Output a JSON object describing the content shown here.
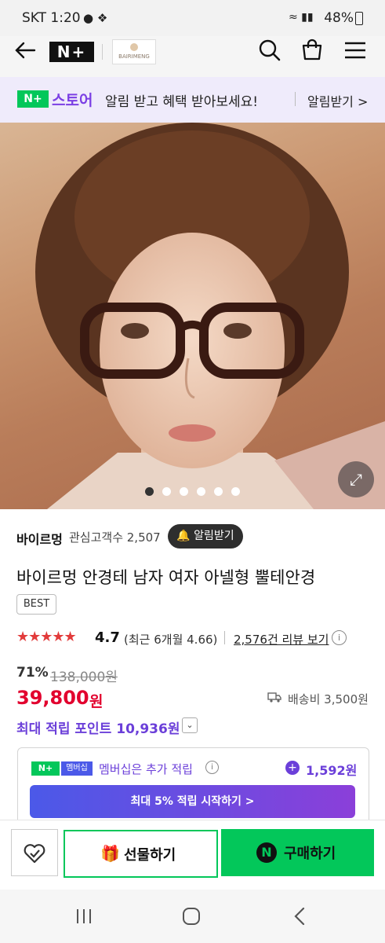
{
  "status_bar": {
    "time": "SKT 1:20",
    "battery": "48%"
  },
  "header": {
    "logo_text": "N+",
    "brand_logo_text": "BAIRIMENG"
  },
  "promo_banner": {
    "badge": "N+",
    "store_label": "스토어",
    "message": "알림 받고 혜택 받아보세요!",
    "action_label": "알림받기 >"
  },
  "gallery": {
    "total_images": 6,
    "current_index": 1
  },
  "seller": {
    "name": "바이르멍",
    "followers_label": "관심고객수 2,507",
    "alert_button": "알림받기"
  },
  "product": {
    "title": "바이르멍 안경테 남자 여자 아넬형 뿔테안경",
    "badge": "BEST",
    "stars": "★★★★★",
    "rating": "4.7",
    "rating_recent": "(최근 6개월 4.66)",
    "review_link": "2,576건 리뷰 보기",
    "discount": "71%",
    "original_price": "138,000원",
    "price": "39,800",
    "price_unit": "원",
    "shipping": "배송비 3,500원",
    "points": "최대 적립 포인트 10,936원"
  },
  "membership": {
    "badge_n": "N+",
    "badge_label": "멤버십",
    "text": "멤버십은 추가 적립",
    "amount": "1,592원",
    "cta": "최대 5% 적립 시작하기 >"
  },
  "bottom_bar": {
    "gift_label": "선물하기",
    "buy_label": "구매하기",
    "buy_icon": "N"
  },
  "colors": {
    "accent_purple": "#6b3fd9",
    "naver_green": "#03c75a",
    "price_red": "#e2002e"
  }
}
